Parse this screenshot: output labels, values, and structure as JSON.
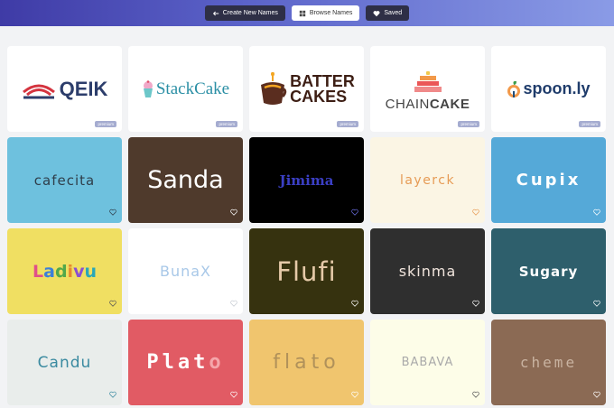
{
  "nav": {
    "create_label": "Create New Names",
    "browse_label": "Browse Names",
    "saved_label": "Saved"
  },
  "premium_logos": [
    {
      "name": "QEIK",
      "badge": "premium"
    },
    {
      "name": "StackCake",
      "badge": "premium"
    },
    {
      "name_line1": "BATTER",
      "name_line2": "CAKES",
      "badge": "premium"
    },
    {
      "name_part1": "CHAIN",
      "name_part2": "CAKE",
      "badge": "premium"
    },
    {
      "name": "spoon.ly",
      "badge": "premium"
    }
  ],
  "names": [
    {
      "text": "cafecita"
    },
    {
      "text": "Sanda"
    },
    {
      "text": "Jimima"
    },
    {
      "text": "layerck"
    },
    {
      "text": "Cupix"
    },
    {
      "text": "Ladivu"
    },
    {
      "text": "BunaX"
    },
    {
      "text": "Flufi"
    },
    {
      "text": "skinma"
    },
    {
      "text": "Sugary"
    },
    {
      "text": "Candu"
    },
    {
      "text": "Plato"
    },
    {
      "text": "flato"
    },
    {
      "text": "BABAVA"
    },
    {
      "text": "cheme"
    }
  ],
  "colors": {
    "header_gradient_start": "#3f3ba6",
    "header_gradient_end": "#8a9be6",
    "badge": "#a5acd0"
  }
}
